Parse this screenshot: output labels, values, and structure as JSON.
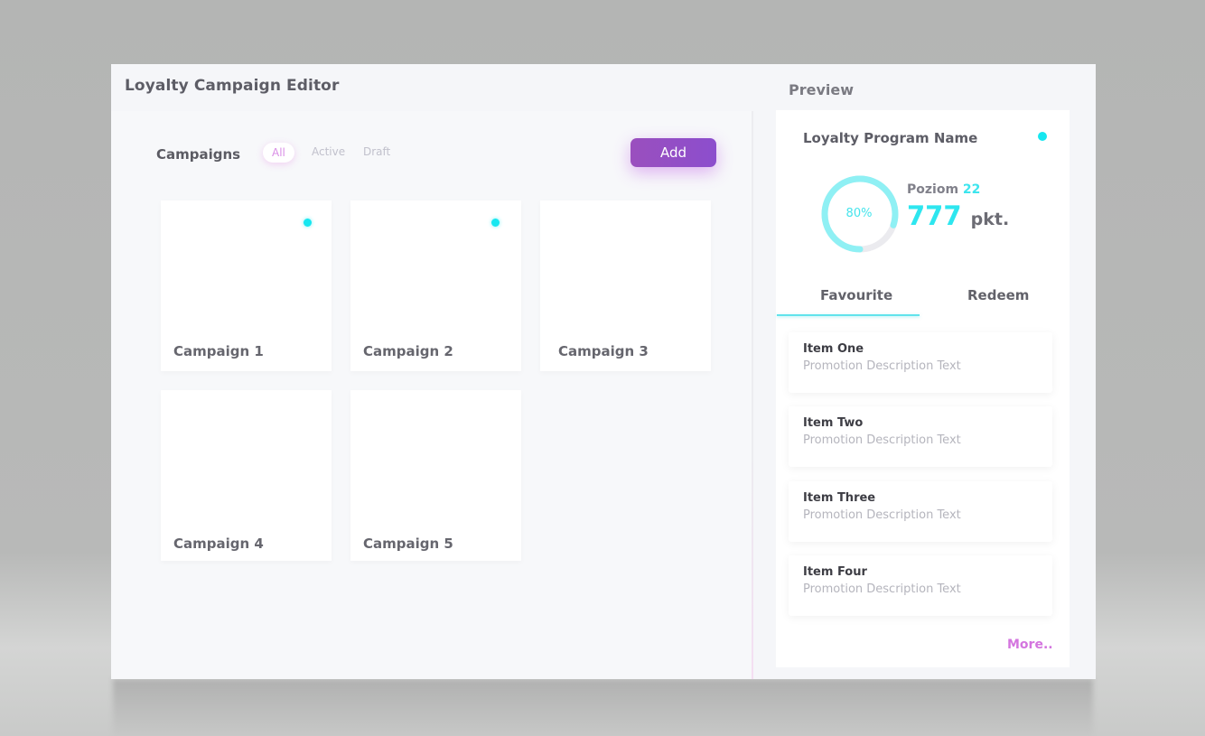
{
  "header": {
    "title": "Loyalty Campaign Editor"
  },
  "campaigns": {
    "label": "Campaigns",
    "filters": {
      "all": "All",
      "active": "Active",
      "draft": "Draft"
    },
    "add_label": "Add",
    "cards": [
      {
        "name": "Campaign 1",
        "has_status_dot": true
      },
      {
        "name": "Campaign 2",
        "has_status_dot": true
      },
      {
        "name": "Campaign 3",
        "has_status_dot": false
      },
      {
        "name": "Campaign 4",
        "has_status_dot": false
      },
      {
        "name": "Campaign 5",
        "has_status_dot": false
      }
    ]
  },
  "preview": {
    "title": "Preview",
    "program_name": "Loyalty Program Name",
    "progress_percent": 80,
    "progress_label": "80%",
    "level_label": "Poziom",
    "level_value": "22",
    "points_value": "777",
    "points_unit": "pkt.",
    "tabs": {
      "favourite": "Favourite",
      "redeem": "Redeem"
    },
    "items": [
      {
        "title": "Item One",
        "description": "Promotion Description Text"
      },
      {
        "title": "Item Two",
        "description": "Promotion Description Text"
      },
      {
        "title": "Item Three",
        "description": "Promotion Description Text"
      },
      {
        "title": "Item Four",
        "description": "Promotion Description Text"
      }
    ],
    "more_label": "More.."
  },
  "colors": {
    "accent_cyan": "#16e7f0",
    "accent_purple": "#9a4fbe",
    "accent_pink": "#d475df"
  }
}
